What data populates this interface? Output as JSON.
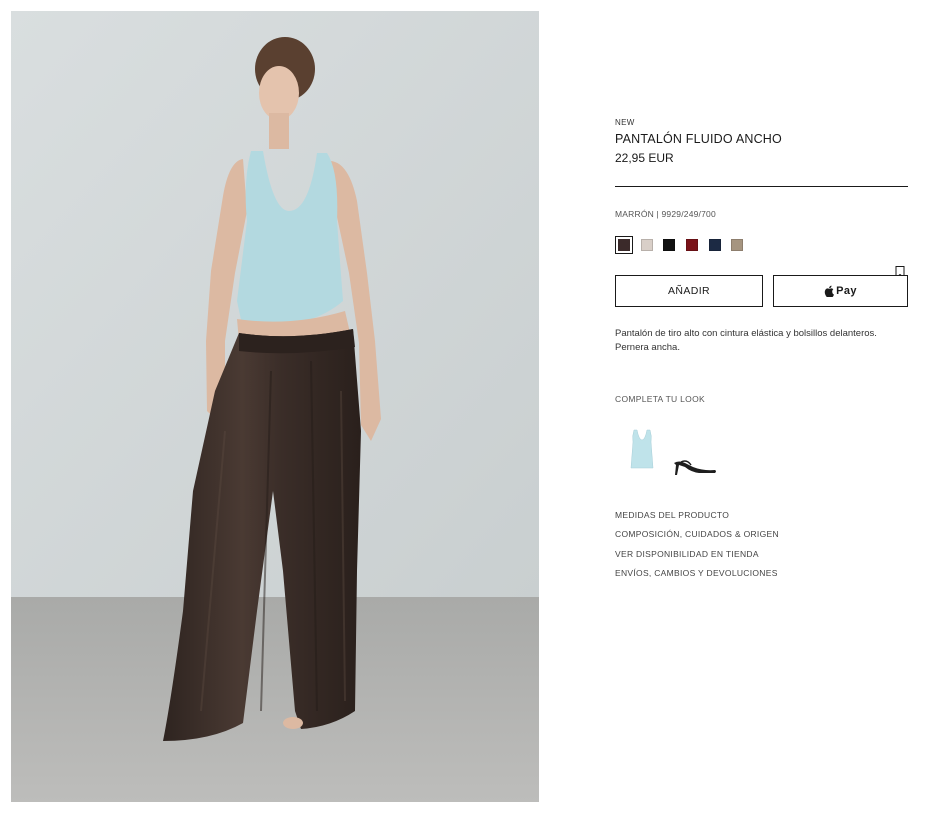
{
  "product": {
    "badge": "NEW",
    "title": "PANTALÓN FLUIDO ANCHO",
    "price": "22,95 EUR",
    "color_ref": "MARRÓN | 9929/249/700",
    "description": "Pantalón de tiro alto con cintura elástica y bolsillos delanteros. Pernera ancha."
  },
  "swatches": [
    {
      "name": "marron",
      "color": "#3b2a2a",
      "selected": true
    },
    {
      "name": "crudo",
      "color": "#d9cfc8",
      "selected": false
    },
    {
      "name": "negro",
      "color": "#111111",
      "selected": false
    },
    {
      "name": "rojo",
      "color": "#7a1218",
      "selected": false
    },
    {
      "name": "azul-marino",
      "color": "#1c2a44",
      "selected": false
    },
    {
      "name": "topo",
      "color": "#a69580",
      "selected": false
    }
  ],
  "actions": {
    "add_label": "AÑADIR",
    "pay_label": "Pay"
  },
  "complete_look": {
    "title": "COMPLETA TU LOOK",
    "items": [
      "tank-top",
      "heeled-sandal"
    ]
  },
  "links": [
    "MEDIDAS DEL PRODUCTO",
    "COMPOSICIÓN, CUIDADOS & ORIGEN",
    "VER DISPONIBILIDAD EN TIENDA",
    "ENVÍOS, CAMBIOS Y DEVOLUCIONES"
  ],
  "icons": {
    "bookmark": "bookmark-icon",
    "apple": "apple-icon"
  }
}
